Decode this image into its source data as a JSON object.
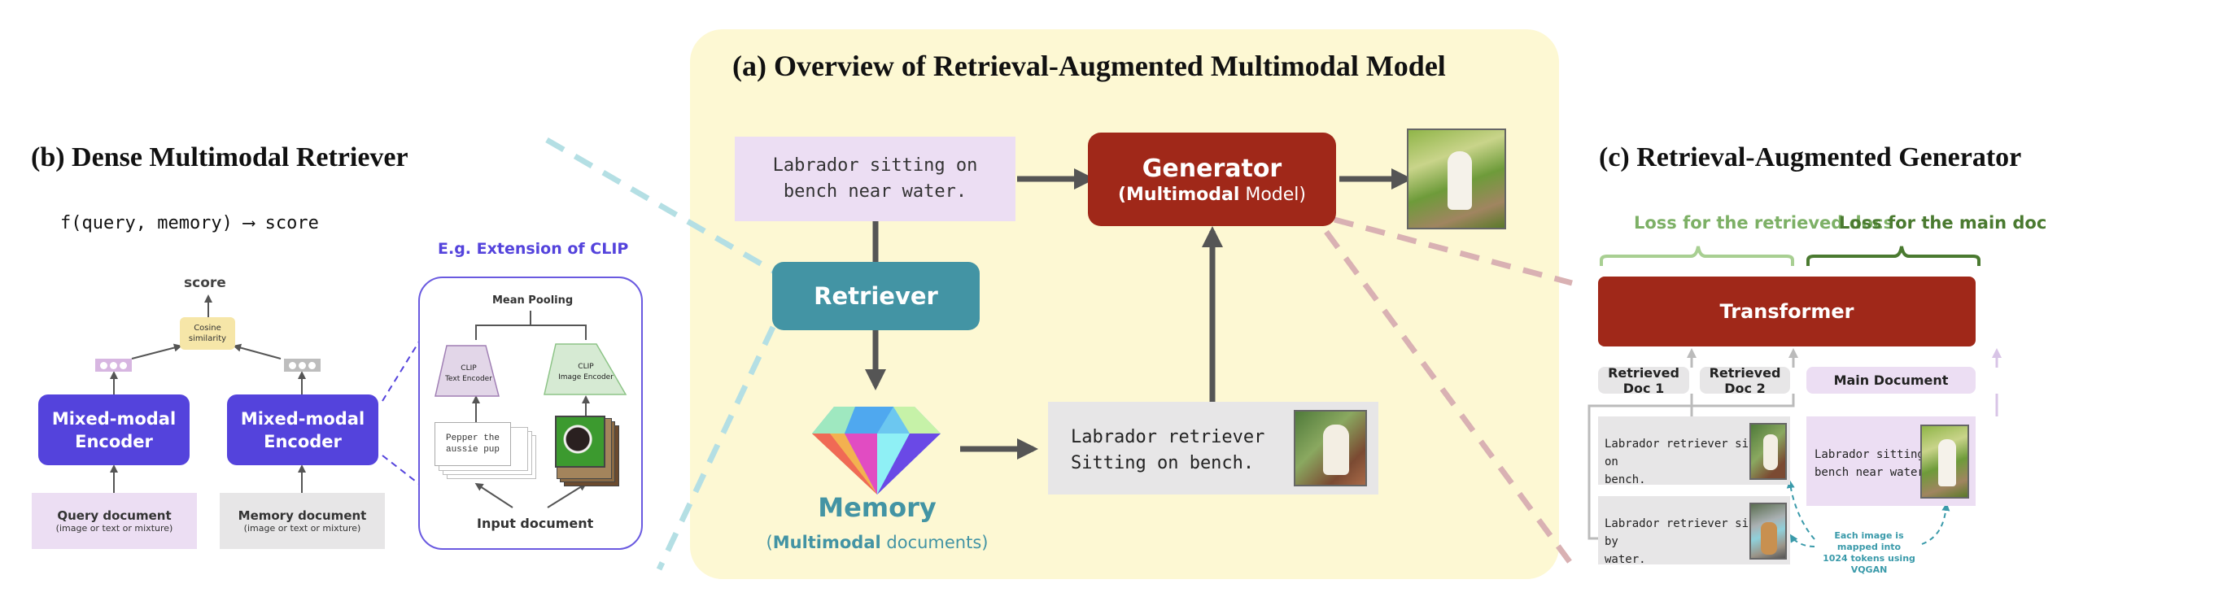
{
  "colors": {
    "panel_a_bg": "#fdf8d3",
    "query_box": "#ecdef3",
    "generator": "#a02819",
    "retriever": "#4394a4",
    "memory_text": "#4394a4",
    "retrieved_box": "#e7e6e7",
    "encoder": "#5443dc",
    "clip_label": "#5443dc",
    "cosine_box": "#f6e6a8",
    "loss_retrieved": "#7db066",
    "loss_main": "#4a7a30",
    "vqgan_note": "#3a9aaa",
    "dash_teal": "#b4dfe4",
    "dash_pink": "#d9b1b3"
  },
  "panel_a": {
    "title": "(a)  Overview of Retrieval-Augmented Multimodal Model",
    "query_text_line1": "Labrador sitting on",
    "query_text_line2": "bench near water.",
    "generator_label": "Generator",
    "generator_sub_bold": "(Multimodal",
    "generator_sub_rest": " Model)",
    "retriever_label": "Retriever",
    "memory_label": "Memory",
    "memory_sub_open": "(",
    "memory_sub_bold": "Multimodal",
    "memory_sub_rest": " documents)",
    "retrieved_text_line1": "Labrador retriever",
    "retrieved_text_line2": "Sitting on bench.",
    "output_image_alt": "golden retriever sitting on bench near water",
    "retrieved_image_alt": "labrador on bench"
  },
  "panel_b": {
    "title": "(b)  Dense Multimodal Retriever",
    "formula": "f(query, memory) ⟶ score",
    "score_label": "score",
    "cosine_line1": "Cosine",
    "cosine_line2": "similarity",
    "encoder_line1": "Mixed-modal",
    "encoder_line2": "Encoder",
    "query_doc_title": "Query document",
    "query_doc_sub": "(image or text or mixture)",
    "memory_doc_title": "Memory document",
    "memory_doc_sub": "(image or text or mixture)",
    "clip_heading": "E.g. Extension of CLIP",
    "mean_pooling": "Mean Pooling",
    "clip_text_enc_line1": "CLIP",
    "clip_text_enc_line2": "Text Encoder",
    "clip_image_enc_line1": "CLIP",
    "clip_image_enc_line2": "Image Encoder",
    "pepper_line1": "Pepper the",
    "pepper_line2": "aussie pup",
    "input_document": "Input document"
  },
  "panel_c": {
    "title": "(c)  Retrieval-Augmented Generator",
    "loss_retrieved": "Loss for the retrieved docs",
    "loss_main": "Loss for the main doc",
    "transformer": "Transformer",
    "retrieved_doc_1": "Retrieved Doc 1",
    "retrieved_doc_2": "Retrieved Doc 2",
    "main_document": "Main Document",
    "doc1_line1": "Labrador retriever sitting on",
    "doc1_line2": "bench.",
    "doc2_line1": "Labrador retriever sitting by",
    "doc2_line2": "water.",
    "main_line1": "Labrador sitting on",
    "main_line2": "bench near water.",
    "vqgan_line1": "Each image is mapped into",
    "vqgan_line2": "1024 tokens using VQGAN"
  }
}
